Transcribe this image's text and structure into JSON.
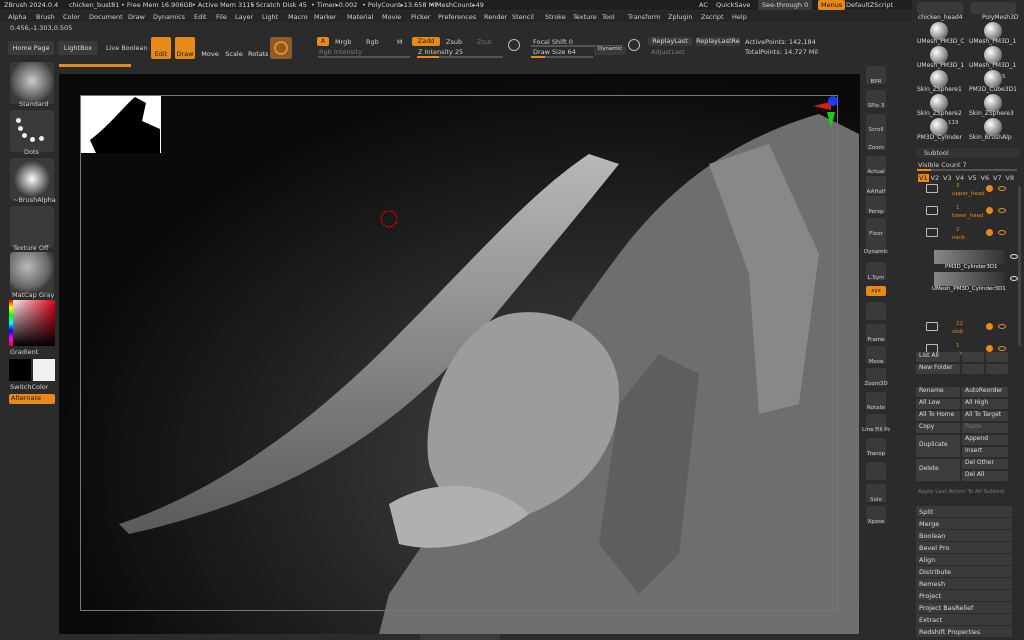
{
  "titlebar": {
    "app": "ZBrush 2024.0.4",
    "file": "chicken_bust81",
    "free_mem": "• Free Mem 16.906GB",
    "active_mem": "• Active Mem 3115",
    "scratch": "• Scratch Disk 45",
    "timer": "• Timer▸0.002",
    "polycount": "• PolyCount▸13.658 MP",
    "meshcount": "• MeshCount▸49",
    "ac": "AC",
    "quicksave": "QuickSave",
    "see_through": "See-through   0",
    "menus": "Menus",
    "zscript": "DefaultZScript"
  },
  "menubar": [
    "Alpha",
    "Brush",
    "Color",
    "Document",
    "Draw",
    "Dynamics",
    "Edit",
    "File",
    "Layer",
    "Light",
    "Macro",
    "Marker",
    "Material",
    "Movie",
    "Picker",
    "Preferences",
    "Render",
    "Stencil",
    "Stroke",
    "Texture",
    "Tool",
    "Transform",
    "Zplugin",
    "Zscript",
    "Help"
  ],
  "coords": "0.456,-1.303,0.505",
  "toolbar": {
    "home_page": "Home Page",
    "lightbox": "LightBox",
    "live_boolean": "Live Boolean",
    "edit": "Edit",
    "draw": "Draw",
    "move": "Move",
    "scale": "Scale",
    "rotate": "Rotate",
    "a": "A",
    "mrgb": "Mrgb",
    "rgb": "Rgb",
    "m": "M",
    "zadd": "Zadd",
    "zsub": "Zsub",
    "zcut": "Zcut",
    "rgb_intensity": "Rgb Intensity",
    "z_intensity": "Z Intensity 25",
    "z_intensity_value": 25,
    "focal_shift": "Focal Shift 0",
    "draw_size": "Draw Size 64",
    "draw_size_value": 64,
    "dynamic": "Dynamic",
    "replay_last": "ReplayLast",
    "replay_last_rel": "ReplayLastRel",
    "adjust_last": "AdjustLast",
    "active_points": "ActivePoints: 142,184",
    "total_points": "TotalPoints: 14.727 Mil"
  },
  "leftpanel": {
    "standard": "Standard",
    "dots": "Dots",
    "brush_alpha": "~BrushAlpha",
    "texture_off": "Texture Off",
    "matcap": "MatCap Gray",
    "gradient": "Gradient",
    "switch_color": "SwitchColor",
    "alternate": "Alternate"
  },
  "shelf": [
    "BPR",
    "SPix 3",
    "Scroll",
    "Zoom",
    "Actual",
    "AAHalf",
    "Persp",
    "Floor",
    "Dynamic",
    "L.Sym",
    "xyz",
    "",
    "Frame",
    "Move",
    "Zoom3D",
    "Rotate",
    "Line Fill PolyF",
    "Transp",
    "",
    "Solo",
    "Xpose"
  ],
  "tools": {
    "top": [
      "chicken_head4",
      "PolyMesh3D"
    ],
    "rows": [
      [
        "UMesh_PM3D_C",
        "UMesh_PM3D_1"
      ],
      [
        "UMesh_PM3D_1",
        "UMesh_PM3D_1"
      ],
      [
        "Skin_ZSphere1",
        "PM3D_Cube3D1"
      ],
      [
        "Skin_ZSphere2",
        "Skin_ZSphere3"
      ],
      [
        "PM3D_Cylinder",
        "Skin_BrushAlp"
      ]
    ],
    "badge_5": "5",
    "badge_119": "119"
  },
  "subtool": {
    "title": "Subtool",
    "visible_count": "Visible Count 7",
    "visible_count_value": 7,
    "visible_count_max": 50,
    "versions": [
      "V1",
      "V2",
      "V3",
      "V4",
      "V5",
      "V6",
      "V7",
      "V8"
    ],
    "items": [
      {
        "num": "3",
        "name": "upper_head"
      },
      {
        "num": "1",
        "name": "lower_head"
      },
      {
        "num": "2",
        "name": "neck"
      },
      {
        "num": "",
        "name": "PM3D_Cylinder3D1"
      },
      {
        "num": "",
        "name": "UMesh_PM3D_Cylinder3D1"
      },
      {
        "num": "22",
        "name": "slob"
      },
      {
        "num": "1",
        "name": "spine"
      }
    ],
    "list_all": "List All",
    "new_folder": "New Folder",
    "rename": "Rename",
    "auto_reorder": "AutoReorder",
    "all_low": "All Low",
    "all_high": "All High",
    "all_to_home": "All To Home",
    "all_to_target": "All To Target",
    "copy": "Copy",
    "paste": "Paste",
    "duplicate": "Duplicate",
    "append": "Append",
    "insert": "Insert",
    "delete": "Delete",
    "del_other": "Del Other",
    "del_all": "Del All",
    "apply_last": "Apply Last Action To All Subtool",
    "sections": [
      "Split",
      "Merge",
      "Boolean",
      "Bevel Pro",
      "Align",
      "Distribute",
      "Remesh",
      "Project",
      "Project BasRelief",
      "Extract",
      "Redshift Properties"
    ]
  },
  "colors": {
    "accent": "#e88a1a",
    "panel": "#2b2b2b",
    "button": "#3a3a3a",
    "canvas": "#0a0a0a"
  }
}
